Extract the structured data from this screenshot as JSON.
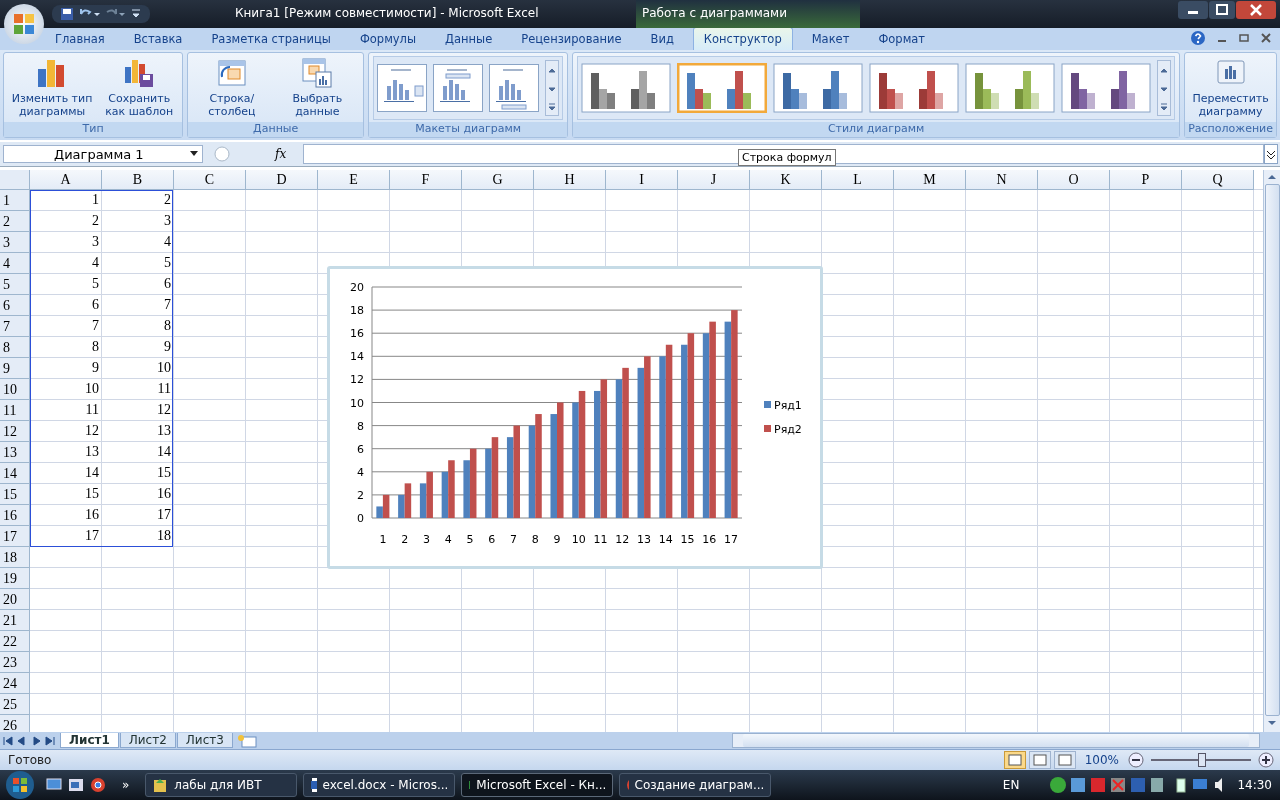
{
  "window": {
    "title": "Книга1  [Режим совместимости] - Microsoft Excel",
    "context_title": "Работа с диаграммами"
  },
  "ribbon_tabs": [
    {
      "label": "Главная",
      "selected": false
    },
    {
      "label": "Вставка",
      "selected": false
    },
    {
      "label": "Разметка страницы",
      "selected": false
    },
    {
      "label": "Формулы",
      "selected": false
    },
    {
      "label": "Данные",
      "selected": false
    },
    {
      "label": "Рецензирование",
      "selected": false
    },
    {
      "label": "Вид",
      "selected": false
    },
    {
      "label": "Конструктор",
      "selected": true
    },
    {
      "label": "Макет",
      "selected": false
    },
    {
      "label": "Формат",
      "selected": false
    }
  ],
  "ribbon_groups": [
    {
      "label": "Тип",
      "kind": "buttons",
      "buttons": [
        {
          "label": "Изменить тип диаграммы"
        },
        {
          "label": "Сохранить как шаблон"
        }
      ]
    },
    {
      "label": "Данные",
      "kind": "buttons",
      "buttons": [
        {
          "label": "Строка/столбец"
        },
        {
          "label": "Выбрать данные"
        }
      ]
    },
    {
      "label": "Макеты диаграмм",
      "kind": "layouts"
    },
    {
      "label": "Стили диаграмм",
      "kind": "styles",
      "styles": [
        {
          "selected": false
        },
        {
          "selected": true
        },
        {
          "selected": false
        },
        {
          "selected": false
        },
        {
          "selected": false
        },
        {
          "selected": false
        }
      ]
    },
    {
      "label": "Расположение",
      "kind": "buttons",
      "buttons": [
        {
          "label": "Переместить диаграмму"
        }
      ]
    }
  ],
  "formula_bar": {
    "name_box": "Диаграмма 1",
    "function_label": "fx",
    "tooltip": "Строка формул"
  },
  "sheet": {
    "columns": [
      "A",
      "B",
      "C",
      "D",
      "E",
      "F",
      "G",
      "H",
      "I",
      "J",
      "K",
      "L",
      "M",
      "N",
      "O",
      "P",
      "Q"
    ],
    "row_numbers": [
      "1",
      "2",
      "3",
      "4",
      "5",
      "6",
      "7",
      "8",
      "9",
      "10",
      "11",
      "12",
      "13",
      "14",
      "15",
      "16",
      "17",
      "18",
      "19",
      "20",
      "21",
      "22",
      "23",
      "24",
      "25",
      "26"
    ],
    "range_outlined": true,
    "cells": [
      [
        "1",
        "2"
      ],
      [
        "2",
        "3"
      ],
      [
        "3",
        "4"
      ],
      [
        "4",
        "5"
      ],
      [
        "5",
        "6"
      ],
      [
        "6",
        "7"
      ],
      [
        "7",
        "8"
      ],
      [
        "8",
        "9"
      ],
      [
        "9",
        "10"
      ],
      [
        "10",
        "11"
      ],
      [
        "11",
        "12"
      ],
      [
        "12",
        "13"
      ],
      [
        "13",
        "14"
      ],
      [
        "14",
        "15"
      ],
      [
        "15",
        "16"
      ],
      [
        "16",
        "17"
      ],
      [
        "17",
        "18"
      ]
    ]
  },
  "chart": {
    "chart_data": {
      "type": "bar",
      "categories": [
        "1",
        "2",
        "3",
        "4",
        "5",
        "6",
        "7",
        "8",
        "9",
        "10",
        "11",
        "12",
        "13",
        "14",
        "15",
        "16",
        "17"
      ],
      "series": [
        {
          "name": "Ряд1",
          "color": "#4f81bd",
          "values": [
            1,
            2,
            3,
            4,
            5,
            6,
            7,
            8,
            9,
            10,
            11,
            12,
            13,
            14,
            15,
            16,
            17
          ]
        },
        {
          "name": "Ряд2",
          "color": "#c0504d",
          "values": [
            2,
            3,
            4,
            5,
            6,
            7,
            8,
            9,
            10,
            11,
            12,
            13,
            14,
            15,
            16,
            17,
            18
          ]
        }
      ],
      "ylim": [
        0,
        20
      ],
      "yticks": [
        0,
        2,
        4,
        6,
        8,
        10,
        12,
        14,
        16,
        18,
        20
      ],
      "grid": true,
      "legend": "right"
    }
  },
  "sheet_tabs": [
    {
      "label": "Лист1",
      "selected": true
    },
    {
      "label": "Лист2",
      "selected": false
    },
    {
      "label": "Лист3",
      "selected": false
    }
  ],
  "status_bar": {
    "status": "Готово",
    "views": [
      {
        "selected": true
      },
      {
        "selected": false
      },
      {
        "selected": false
      }
    ],
    "zoom": "100%",
    "zoom_slider": {
      "level": 0.5
    }
  },
  "taskbar": {
    "overflow": "»",
    "tasks": [
      {
        "label": "лабы для ИВТ",
        "selected": false
      },
      {
        "label": "excel.docx - Micros...",
        "selected": false
      },
      {
        "label": "Microsoft Excel - Кн...",
        "selected": true
      },
      {
        "label": "Создание диаграм...",
        "selected": false
      }
    ],
    "language": "EN",
    "clock": "14:30"
  }
}
